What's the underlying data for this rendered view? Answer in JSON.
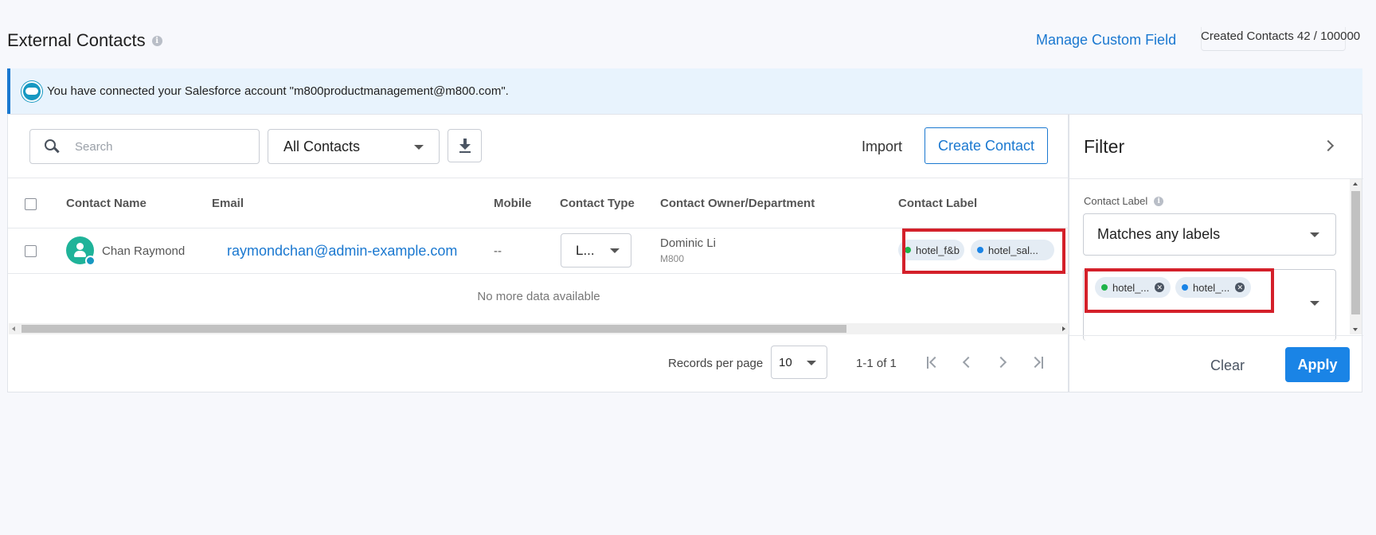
{
  "header": {
    "title": "External Contacts",
    "manage_link": "Manage Custom Field",
    "created_contacts": "Created Contacts 42 / 100000"
  },
  "banner": {
    "text": "You have connected your Salesforce account \"m800productmanagement@m800.com\"."
  },
  "toolbar": {
    "search_placeholder": "Search",
    "contacts_filter": "All Contacts",
    "import_label": "Import",
    "create_label": "Create Contact"
  },
  "table": {
    "columns": [
      "Contact Name",
      "Email",
      "Mobile",
      "Contact Type",
      "Contact Owner/Department",
      "Contact Label"
    ],
    "rows": [
      {
        "name": "Chan Raymond",
        "email": "raymondchan@admin-example.com",
        "mobile": "--",
        "type": "L...",
        "owner": "Dominic Li",
        "department": "M800",
        "labels": [
          {
            "text": "hotel_f&b",
            "color": "#1fb34a"
          },
          {
            "text": "hotel_sal...",
            "color": "#1a84e6"
          }
        ]
      }
    ],
    "empty_text": "No more data available"
  },
  "pagination": {
    "records_label": "Records per page",
    "records_value": "10",
    "range": "1-1 of 1"
  },
  "filter": {
    "title": "Filter",
    "contact_label_title": "Contact Label",
    "match_value": "Matches any labels",
    "chips": [
      {
        "text": "hotel_...",
        "color": "#1fb34a"
      },
      {
        "text": "hotel_...",
        "color": "#1a84e6"
      }
    ],
    "clear_label": "Clear",
    "apply_label": "Apply"
  },
  "colors": {
    "accent": "#1a78d0",
    "apply_bg": "#1a84e6",
    "highlight": "#d4202a",
    "avatar": "#1fb399"
  }
}
